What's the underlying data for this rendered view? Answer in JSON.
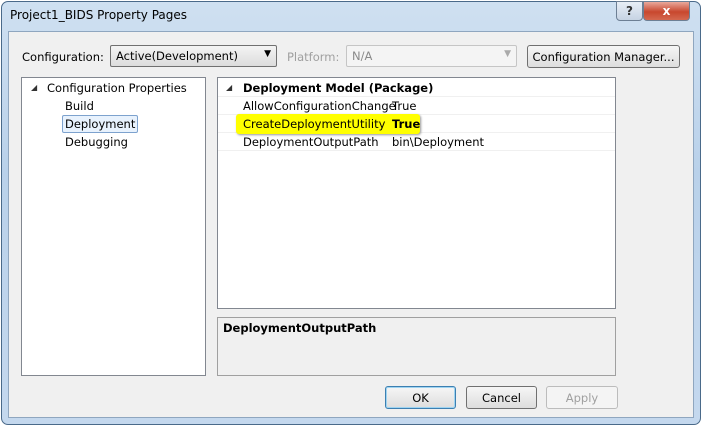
{
  "window": {
    "title": "Project1_BIDS Property Pages",
    "help_label": "?",
    "close_label": "x"
  },
  "toolbar": {
    "configuration_label": "Configuration:",
    "configuration_value": "Active(Development)",
    "platform_label": "Platform:",
    "platform_value": "N/A",
    "config_manager_label": "Configuration Manager..."
  },
  "tree": {
    "root": "Configuration Properties",
    "items": [
      "Build",
      "Deployment",
      "Debugging"
    ],
    "selected": "Deployment"
  },
  "grid": {
    "category": "Deployment Model (Package)",
    "rows": [
      {
        "name": "AllowConfigurationChange",
        "value": "True"
      },
      {
        "name": "CreateDeploymentUtility",
        "value": "True"
      },
      {
        "name": "DeploymentOutputPath",
        "value": "bin\\Deployment"
      }
    ],
    "highlight_color": "#ffff00"
  },
  "description": {
    "title": "DeploymentOutputPath"
  },
  "buttons": {
    "ok": "OK",
    "cancel": "Cancel",
    "apply": "Apply"
  }
}
